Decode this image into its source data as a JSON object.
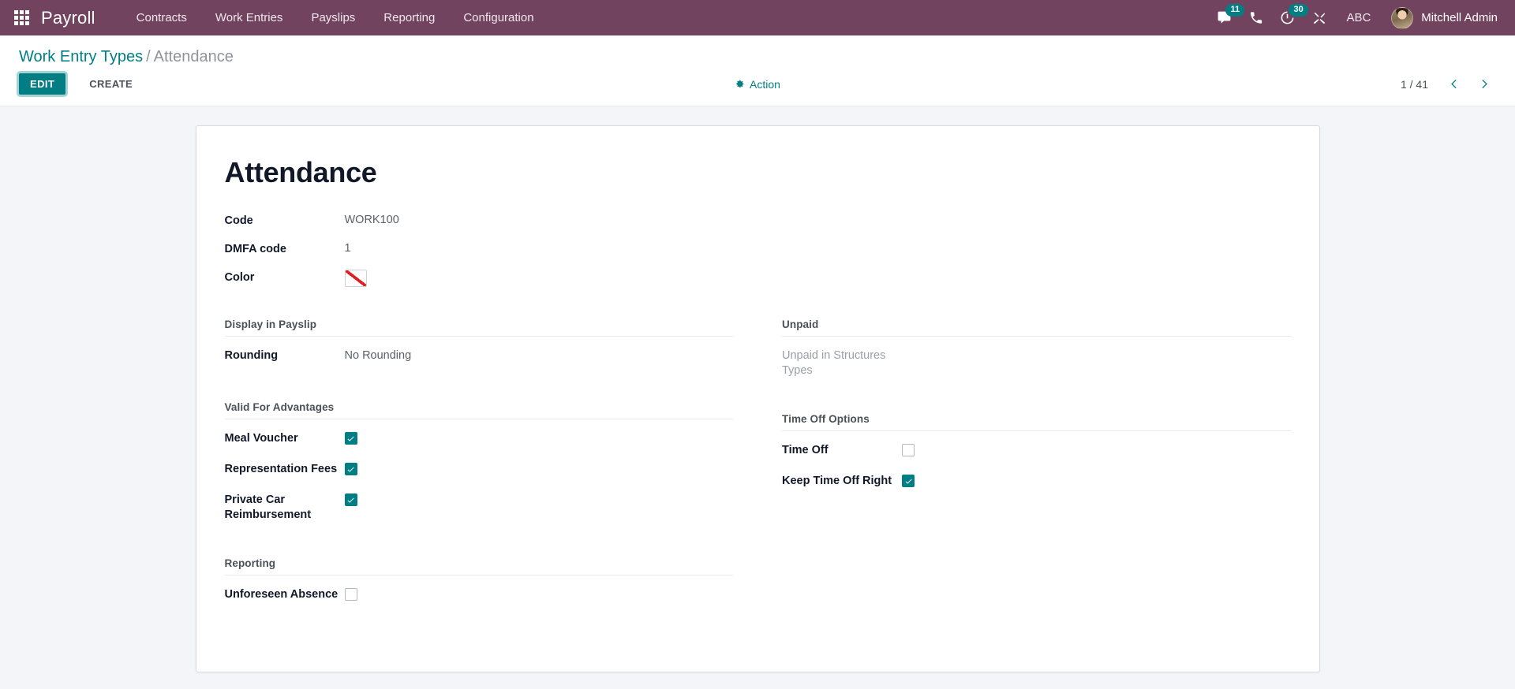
{
  "navbar": {
    "apps_icon": "apps-grid-icon",
    "brand": "Payroll",
    "menus": [
      {
        "label": "Contracts"
      },
      {
        "label": "Work Entries"
      },
      {
        "label": "Payslips"
      },
      {
        "label": "Reporting"
      },
      {
        "label": "Configuration"
      }
    ],
    "messaging": {
      "icon": "chat-bubble-icon",
      "count": "11"
    },
    "voip": {
      "icon": "phone-icon"
    },
    "activities": {
      "icon": "clock-icon",
      "count": "30"
    },
    "debug": {
      "icon": "tools-icon"
    },
    "language": "ABC",
    "user": {
      "name": "Mitchell Admin",
      "avatar": "user-avatar"
    },
    "accent": "#017e84",
    "background": "#71435f"
  },
  "control_panel": {
    "breadcrumb": {
      "parent": "Work Entry Types",
      "separator": "/",
      "current": "Attendance"
    },
    "buttons": {
      "edit": "EDIT",
      "create": "CREATE"
    },
    "action": {
      "label": "Action",
      "icon": "gear-icon"
    },
    "pager": {
      "value": "1 / 41",
      "previous_icon": "chevron-left-icon",
      "next_icon": "chevron-right-icon"
    }
  },
  "form": {
    "title": "Attendance",
    "top_fields": [
      {
        "label": "Code",
        "value": "WORK100",
        "type": "text"
      },
      {
        "label": "DMFA code",
        "value": "1",
        "type": "text"
      },
      {
        "label": "Color",
        "value": "",
        "type": "color",
        "swatch": "no-color"
      }
    ],
    "groups": {
      "display_in_payslip": {
        "title": "Display in Payslip",
        "rows": [
          {
            "label": "Rounding",
            "value": "No Rounding",
            "type": "text"
          }
        ]
      },
      "unpaid": {
        "title": "Unpaid",
        "rows": [
          {
            "label": "Unpaid in Structures Types",
            "value": "",
            "type": "empty"
          }
        ]
      },
      "valid_for_advantages": {
        "title": "Valid For Advantages",
        "rows": [
          {
            "label": "Meal Voucher",
            "type": "checkbox",
            "checked": true
          },
          {
            "label": "Representation Fees",
            "type": "checkbox",
            "checked": true
          },
          {
            "label": "Private Car Reimbursement",
            "type": "checkbox",
            "checked": true
          }
        ]
      },
      "time_off_options": {
        "title": "Time Off Options",
        "rows": [
          {
            "label": "Time Off",
            "type": "checkbox",
            "checked": false
          },
          {
            "label": "Keep Time Off Right",
            "type": "checkbox",
            "checked": true
          }
        ]
      },
      "reporting": {
        "title": "Reporting",
        "rows": [
          {
            "label": "Unforeseen Absence",
            "type": "checkbox",
            "checked": false
          }
        ]
      }
    }
  }
}
